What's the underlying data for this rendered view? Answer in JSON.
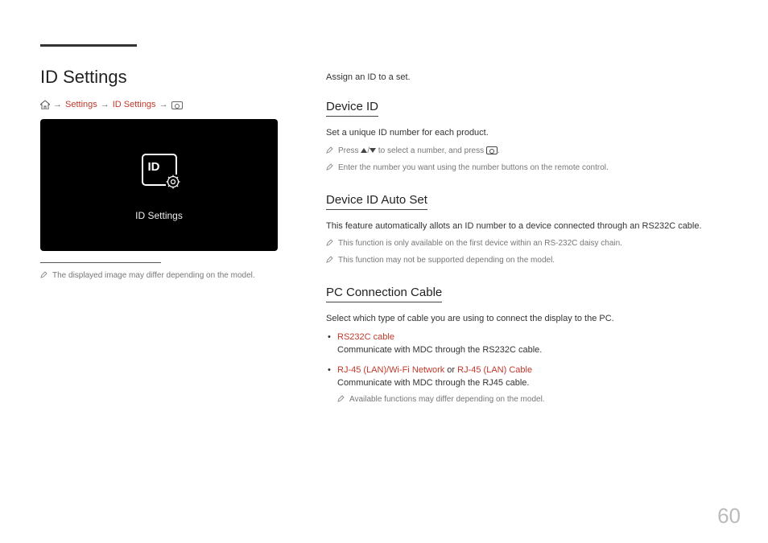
{
  "page_number": "60",
  "left": {
    "title": "ID Settings",
    "breadcrumb": {
      "item1": "Settings",
      "item2": "ID Settings"
    },
    "screenshot_label": "ID Settings",
    "id_icon_text": "ID",
    "disclaimer": "The displayed image may differ depending on the model."
  },
  "right": {
    "intro": "Assign an ID to a set.",
    "device_id": {
      "heading": "Device ID",
      "p1": "Set a unique ID number for each product.",
      "note1_a": "Press ",
      "note1_b": " to select a number, and press ",
      "note1_c": ".",
      "note2": "Enter the number you want using the number buttons on the remote control."
    },
    "auto_set": {
      "heading": "Device ID Auto Set",
      "p1": "This feature automatically allots an ID number to a device connected through an RS232C cable.",
      "note1": "This function is only available on the first device within an RS-232C daisy chain.",
      "note2": "This function may not be supported depending on the model."
    },
    "pc_cable": {
      "heading": "PC Connection Cable",
      "p1": "Select which type of cable you are using to connect the display to the PC.",
      "opt1_label": "RS232C cable",
      "opt1_desc": "Communicate with MDC through the RS232C cable.",
      "opt2_label_a": "RJ-45 (LAN)/Wi-Fi Network",
      "opt2_or": " or ",
      "opt2_label_b": "RJ-45 (LAN) Cable",
      "opt2_desc": "Communicate with MDC through the RJ45 cable.",
      "opt2_note": "Available functions may differ depending on the model."
    }
  }
}
